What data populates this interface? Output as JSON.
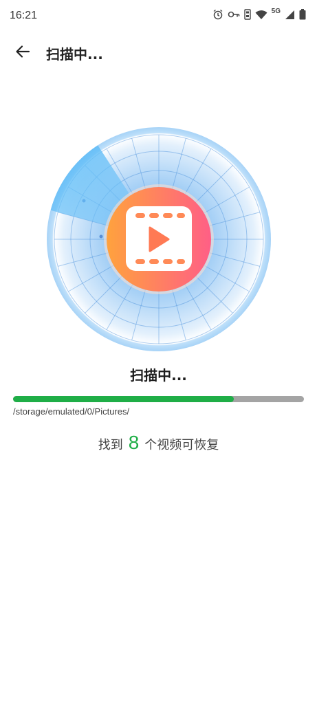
{
  "status_bar": {
    "time": "16:21",
    "network": "5G",
    "icons": [
      "alarm-icon",
      "vpn-key-icon",
      "sim-icon",
      "wifi-icon",
      "network-label",
      "signal-icon",
      "battery-icon"
    ]
  },
  "app_bar": {
    "title": "扫描中...",
    "back_icon": "arrow-left-icon"
  },
  "scanner": {
    "center_icon": "video-film-icon",
    "colors": {
      "gradient_start": "#ffa23d",
      "gradient_end": "#ff5f86",
      "radar_blue": "#4a9be8",
      "sweep_blue": "#5ab8f5"
    }
  },
  "scan_status": "扫描中...",
  "progress": {
    "value": 0.76,
    "fill_color": "#1fae47",
    "track_color": "#a4a4a4"
  },
  "path": "/storage/emulated/0/Pictures/",
  "result": {
    "prefix": "找到",
    "count": "8",
    "suffix": "个视频可恢复"
  }
}
